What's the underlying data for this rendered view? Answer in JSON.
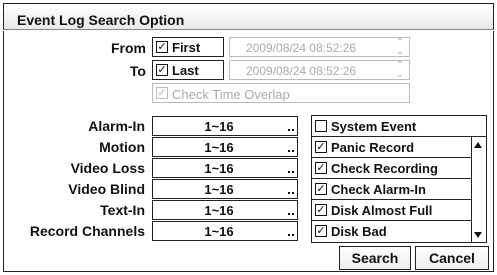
{
  "title": "Event Log Search Option",
  "from": {
    "label": "From",
    "first_label": "First",
    "first_checked": true,
    "datetime": "2009/08/24  08:52:26"
  },
  "to": {
    "label": "To",
    "last_label": "Last",
    "last_checked": true,
    "datetime": "2009/08/24  08:52:26"
  },
  "overlap": {
    "label": "Check Time Overlap",
    "checked": true
  },
  "filters": [
    {
      "label": "Alarm-In",
      "value": "1~16"
    },
    {
      "label": "Motion",
      "value": "1~16"
    },
    {
      "label": "Video Loss",
      "value": "1~16"
    },
    {
      "label": "Video Blind",
      "value": "1~16"
    },
    {
      "label": "Text-In",
      "value": "1~16"
    },
    {
      "label": "Record Channels",
      "value": "1~16"
    }
  ],
  "system_event": {
    "label": "System Event",
    "checked": false,
    "items": [
      {
        "label": "Panic Record",
        "checked": true
      },
      {
        "label": "Check Recording",
        "checked": true
      },
      {
        "label": "Check Alarm-In",
        "checked": true
      },
      {
        "label": "Disk Almost Full",
        "checked": true
      },
      {
        "label": "Disk Bad",
        "checked": true
      }
    ]
  },
  "buttons": {
    "search": "Search",
    "cancel": "Cancel"
  }
}
